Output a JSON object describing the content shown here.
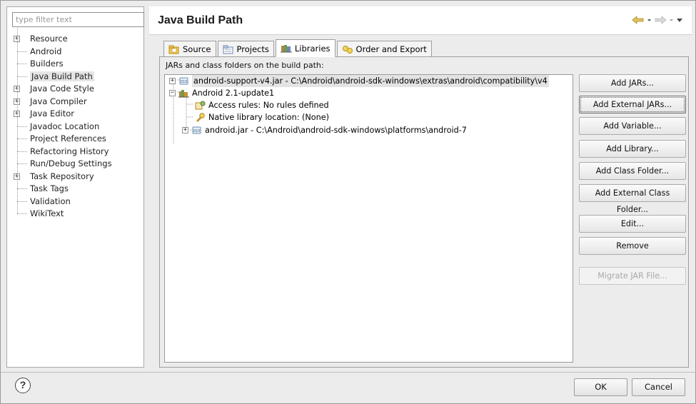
{
  "filter": {
    "placeholder": "type filter text"
  },
  "nav": {
    "items": [
      {
        "label": "Resource",
        "expandable": true
      },
      {
        "label": "Android",
        "expandable": false
      },
      {
        "label": "Builders",
        "expandable": false
      },
      {
        "label": "Java Build Path",
        "expandable": false,
        "selected": true
      },
      {
        "label": "Java Code Style",
        "expandable": true
      },
      {
        "label": "Java Compiler",
        "expandable": true
      },
      {
        "label": "Java Editor",
        "expandable": true
      },
      {
        "label": "Javadoc Location",
        "expandable": false
      },
      {
        "label": "Project References",
        "expandable": false
      },
      {
        "label": "Refactoring History",
        "expandable": false
      },
      {
        "label": "Run/Debug Settings",
        "expandable": false
      },
      {
        "label": "Task Repository",
        "expandable": true
      },
      {
        "label": "Task Tags",
        "expandable": false
      },
      {
        "label": "Validation",
        "expandable": false
      },
      {
        "label": "WikiText",
        "expandable": false
      }
    ]
  },
  "header": {
    "title": "Java Build Path",
    "back_icon": "back-arrow-icon",
    "forward_icon": "forward-arrow-icon"
  },
  "tabs": [
    {
      "label": "Source",
      "icon": "source-folder-icon"
    },
    {
      "label": "Projects",
      "icon": "projects-icon"
    },
    {
      "label": "Libraries",
      "icon": "libraries-icon",
      "active": true
    },
    {
      "label": "Order and Export",
      "icon": "order-export-icon"
    }
  ],
  "panel": {
    "label": "JARs and class folders on the build path:",
    "tree": {
      "support_jar": "android-support-v4.jar - C:\\Android\\android-sdk-windows\\extras\\android\\compatibility\\v4",
      "android_lib": "Android 2.1-update1",
      "access_rules": "Access rules: No rules defined",
      "native_location": "Native library location: (None)",
      "android_jar": "android.jar - C:\\Android\\android-sdk-windows\\platforms\\android-7"
    },
    "buttons": {
      "add_jars": "Add JARs...",
      "add_external_jars": "Add External JARs...",
      "add_variable": "Add Variable...",
      "add_library": "Add Library...",
      "add_class_folder": "Add Class Folder...",
      "add_external_class_folder": "Add External Class Folder...",
      "edit": "Edit...",
      "remove": "Remove",
      "migrate_jar": "Migrate JAR File..."
    }
  },
  "footer": {
    "help": "?",
    "ok": "OK",
    "cancel": "Cancel"
  },
  "colors": {
    "dialog_bg": "#ececec",
    "nav_arrow": "#c9a642",
    "jar_icon": "#6b8fb3",
    "library_icon": "#a66b2a"
  }
}
